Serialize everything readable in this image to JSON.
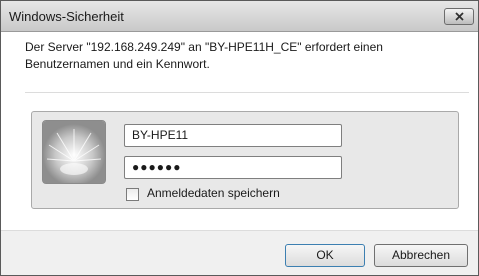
{
  "window": {
    "title": "Windows-Sicherheit"
  },
  "message": {
    "text": "Der Server \"192.168.249.249\" an \"BY-HPE11H_CE\" erfordert einen Benutzernamen und ein Kennwort."
  },
  "credentials": {
    "username_value": "BY-HPE11",
    "password_value": "●●●●●●",
    "remember_label": "Anmeldedaten speichern",
    "remember_checked": false
  },
  "buttons": {
    "ok_label": "OK",
    "cancel_label": "Abbrechen"
  },
  "icons": {
    "close": "close-icon",
    "user_tile": "user-tile-icon"
  },
  "colors": {
    "titlebar": "#d6d6d6",
    "panel": "#e8e8e8",
    "ok_border": "#3c7fb1"
  }
}
